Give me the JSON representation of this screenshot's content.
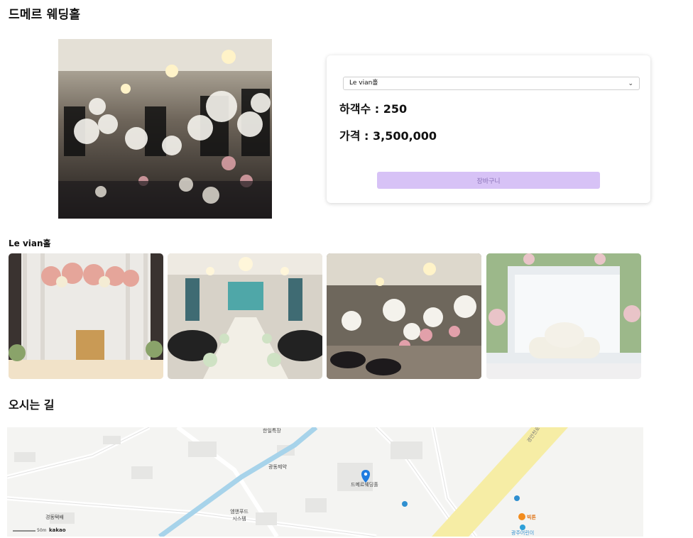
{
  "page": {
    "title": "드메르 웨딩홀"
  },
  "card": {
    "selected_hall": "Le vian홀",
    "guest_text": "하객수 : 250",
    "price_text": "가격 : 3,500,000",
    "cart_label": "장바구니",
    "colors": {
      "cart_bg": "#d7c2f6",
      "cart_text": "#8b73b8"
    }
  },
  "gallery": {
    "title": "Le vian홀",
    "image_count": 4
  },
  "directions": {
    "title": "오시는 길",
    "map": {
      "marker_label": "드메르웨딩홀",
      "places": [
        "한일특장",
        "광동제약",
        "경동택배",
        "엠앤푸드 시스템",
        "빅톤",
        "광주어린이"
      ],
      "road_label": "경안천로",
      "scale_label": "50m",
      "brand": "kakao"
    }
  }
}
